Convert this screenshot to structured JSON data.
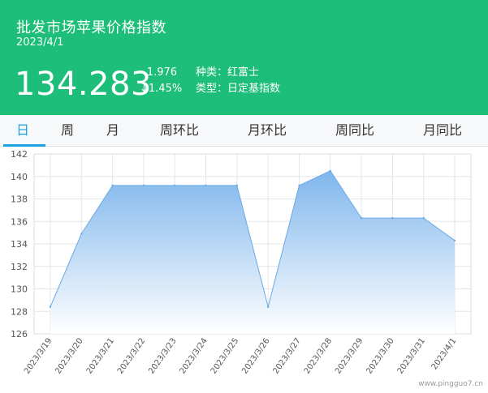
{
  "header": {
    "title": "批发市场苹果价格指数",
    "date": "2023/4/1",
    "index_value": "134.283",
    "change_abs": "- 1.976",
    "change_pct": "↓1.45%",
    "variety": "种类：红富士",
    "type": "类型：日定基指数"
  },
  "tabs": [
    {
      "label": "日",
      "active": true
    },
    {
      "label": "周",
      "active": false
    },
    {
      "label": "月",
      "active": false
    },
    {
      "label": "周环比",
      "active": false
    },
    {
      "label": "月环比",
      "active": false
    },
    {
      "label": "周同比",
      "active": false
    },
    {
      "label": "月同比",
      "active": false
    }
  ],
  "watermark": "www.pingguo7.cn",
  "colors": {
    "header_bg": "#1dbe7a",
    "tab_active": "#1aa3e0",
    "area_fill_top": "#7fb6ec",
    "area_line": "#6aaae6"
  },
  "chart_data": {
    "type": "area",
    "x": [
      "2023/3/19",
      "2023/3/20",
      "2023/3/21",
      "2023/3/22",
      "2023/3/23",
      "2023/3/24",
      "2023/3/25",
      "2023/3/26",
      "2023/3/27",
      "2023/3/28",
      "2023/3/29",
      "2023/3/30",
      "2023/3/31",
      "2023/4/1"
    ],
    "values": [
      128.4,
      134.9,
      139.2,
      139.2,
      139.2,
      139.2,
      139.2,
      128.4,
      139.2,
      140.5,
      136.3,
      136.3,
      136.3,
      134.3
    ],
    "yticks": [
      126,
      128,
      130,
      132,
      134,
      136,
      138,
      140,
      142
    ],
    "ylim": [
      126,
      142
    ],
    "grid": true,
    "legend": "none"
  }
}
